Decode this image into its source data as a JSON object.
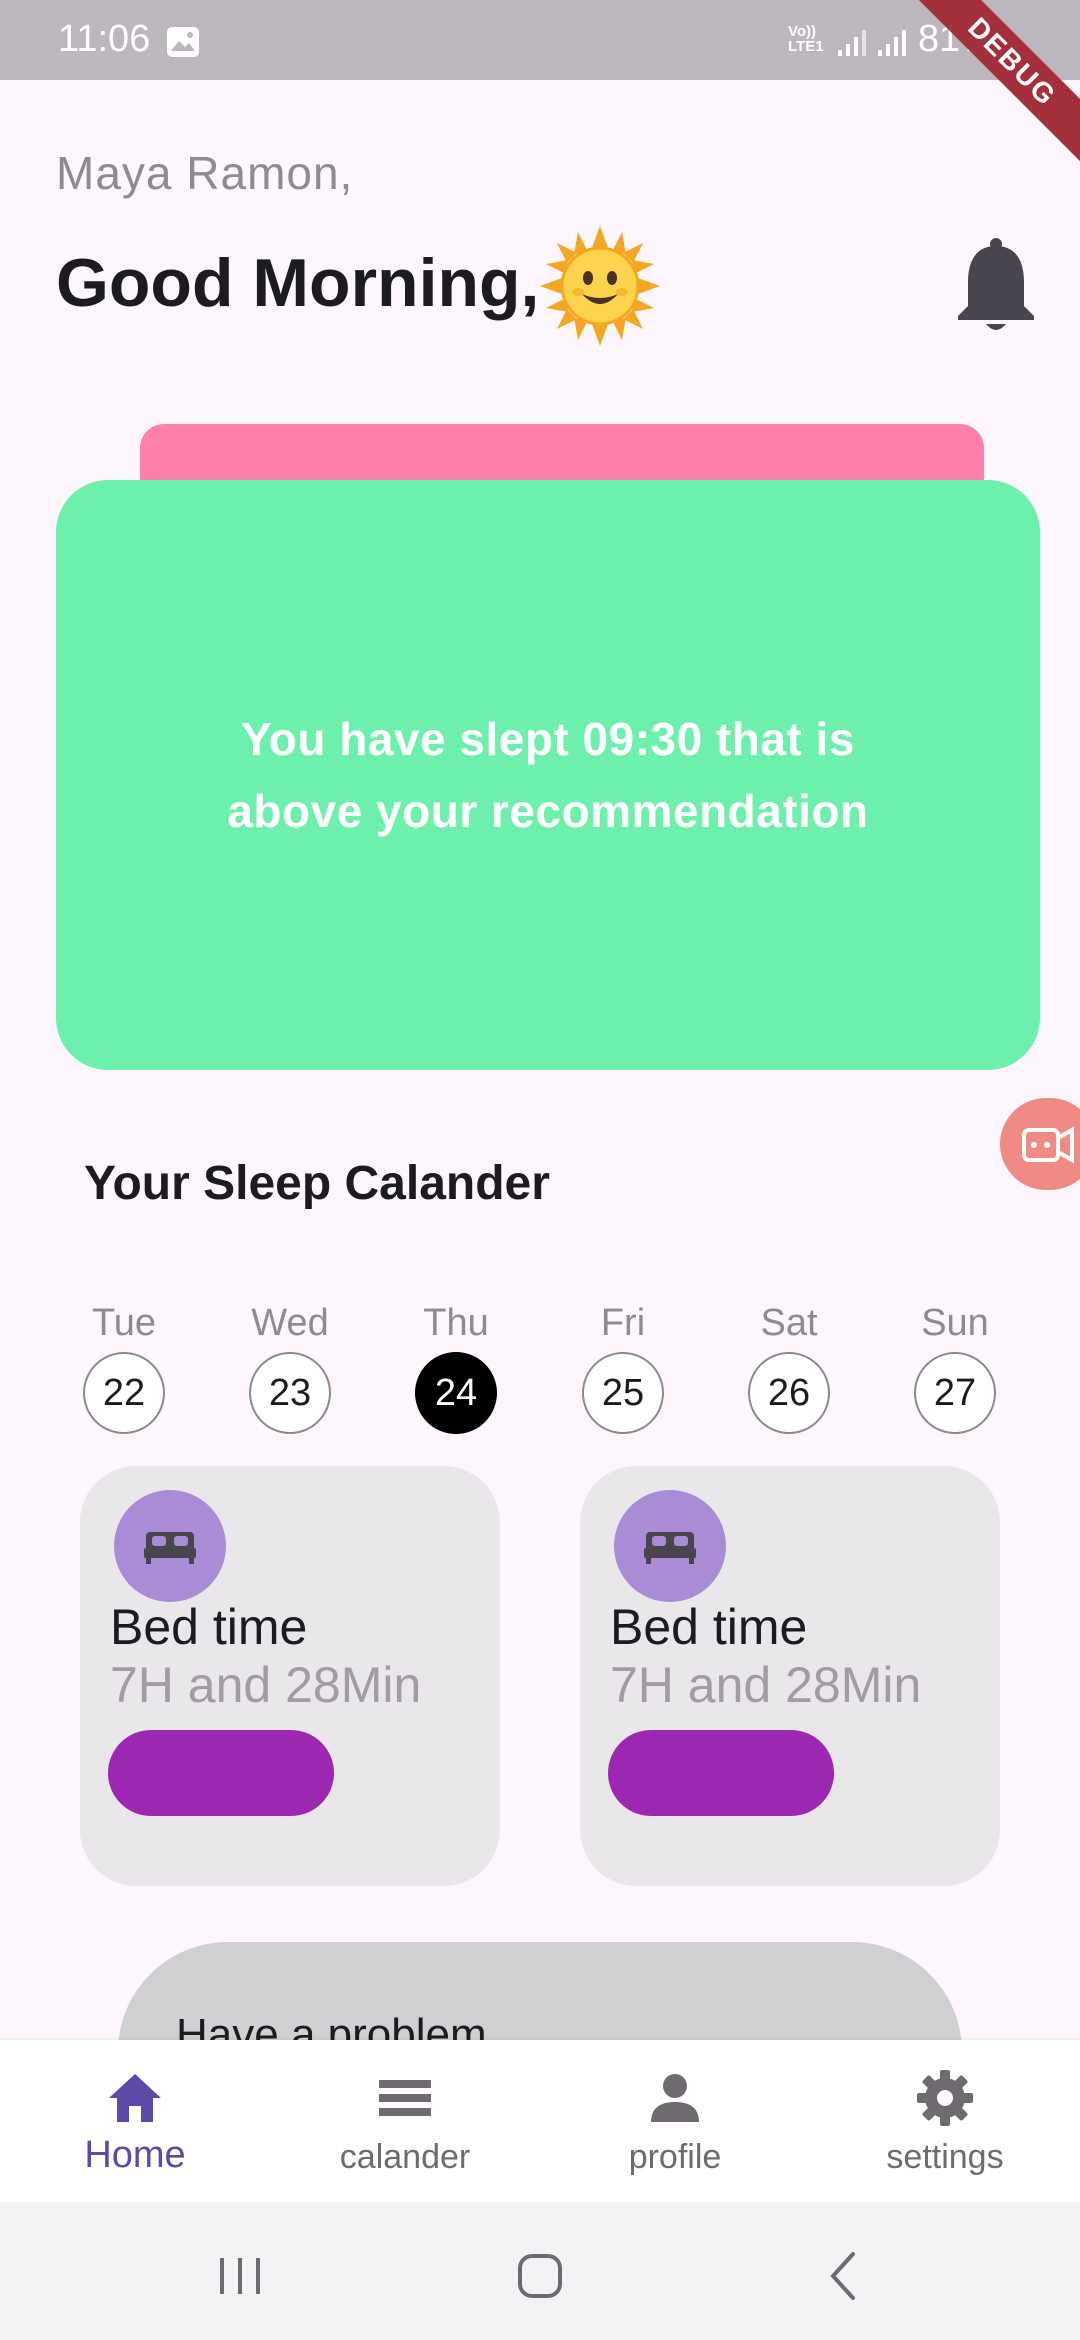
{
  "status_bar": {
    "time": "11:06",
    "volte": "Vo)) LTE1",
    "battery": "81%",
    "debug_label": "DEBUG"
  },
  "header": {
    "user_name": "Maya Ramon,",
    "greeting": "Good Morning,",
    "greeting_icon": "sun-face-emoji",
    "notification_icon": "bell-icon"
  },
  "sleep_card": {
    "message": "You have slept 09:30  that is above your recommendation",
    "color": "#6cf0ac",
    "back_color": "#ff80aa"
  },
  "calendar": {
    "title": "Your Sleep Calander",
    "days": [
      {
        "name": "Tue",
        "date": "22"
      },
      {
        "name": "Wed",
        "date": "23"
      },
      {
        "name": "Thu",
        "date": "24"
      },
      {
        "name": "Fri",
        "date": "25"
      },
      {
        "name": "Sat",
        "date": "26"
      },
      {
        "name": "Sun",
        "date": "27"
      }
    ],
    "selected_day": "24"
  },
  "bed_cards": [
    {
      "title": "Bed time",
      "duration": "7H and 28Min",
      "icon": "bed-icon"
    },
    {
      "title": "Bed time",
      "duration": "7H and 28Min",
      "icon": "bed-icon"
    }
  ],
  "problem_card": {
    "text": "Have a problem"
  },
  "bottom_nav": {
    "items": [
      {
        "label": "Home",
        "icon": "home-icon",
        "active": true
      },
      {
        "label": "calander",
        "icon": "calendar-list-icon",
        "active": false
      },
      {
        "label": "profile",
        "icon": "person-icon",
        "active": false
      },
      {
        "label": "settings",
        "icon": "gear-icon",
        "active": false
      }
    ],
    "active_color": "#5e48a8"
  }
}
